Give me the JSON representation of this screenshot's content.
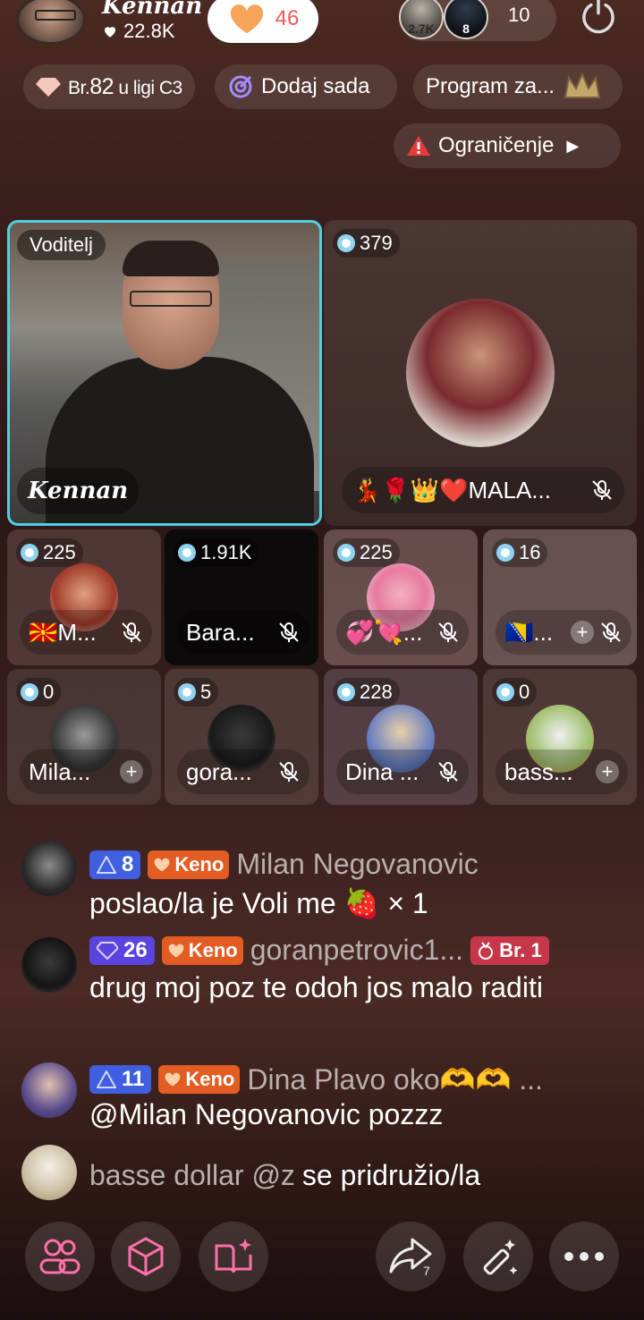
{
  "header": {
    "host_name": "Kennan",
    "host_likes": "22.8K",
    "follow_count": "46",
    "viewer_avatars": [
      "2.7K",
      "8"
    ],
    "viewer_count": "10"
  },
  "badges": {
    "rank_prefix": "Br.",
    "rank_num": "82",
    "rank_suffix": "u ligi C3",
    "add_now": "Dodaj sada",
    "program": "Program za...",
    "limit": "Ograničenje"
  },
  "host_tile": {
    "role_label": "Voditelj",
    "name": "Kennan"
  },
  "guest_tiles": [
    {
      "coins": "379",
      "name": "💃🌹👑❤️MALA...",
      "muted": true
    },
    {
      "coins": "225",
      "name": "🇲🇰M...",
      "muted": true
    },
    {
      "coins": "1.91K",
      "name": "Bara...",
      "muted": true
    },
    {
      "coins": "225",
      "name": "💞💘...",
      "muted": true
    },
    {
      "coins": "16",
      "name": "🇧🇦...",
      "muted": true
    },
    {
      "coins": "0",
      "name": "Mila...",
      "muted": false
    },
    {
      "coins": "5",
      "name": "gora...",
      "muted": true
    },
    {
      "coins": "228",
      "name": "Dina ...",
      "muted": true
    },
    {
      "coins": "0",
      "name": "bass...",
      "muted": false
    }
  ],
  "chat": [
    {
      "level": "8",
      "badge": "Keno",
      "user": "Milan Negovanovic",
      "text": "poslao/la je Voli me 🍓 × 1"
    },
    {
      "level": "26",
      "badge": "Keno",
      "user": "goranpetrovic1...",
      "rank_badge": "Br. 1",
      "text": "drug moj poz te odoh jos malo raditi"
    },
    {
      "level": "11",
      "badge": "Keno",
      "user": "Dina Plavo oko🫶🫶 ...",
      "text": "@Milan Negovanovic pozzz"
    },
    {
      "user": "basse dollar @z",
      "text": "se pridružio/la"
    }
  ],
  "bottom_bar": {
    "share_count": "7"
  },
  "colors": {
    "accent_cyan": "#4fd0e0",
    "keno_orange": "#e35c22",
    "level_blue": "#3f5fe0",
    "rank_red": "#c7374a",
    "follow_count_red": "#f45a5a"
  }
}
